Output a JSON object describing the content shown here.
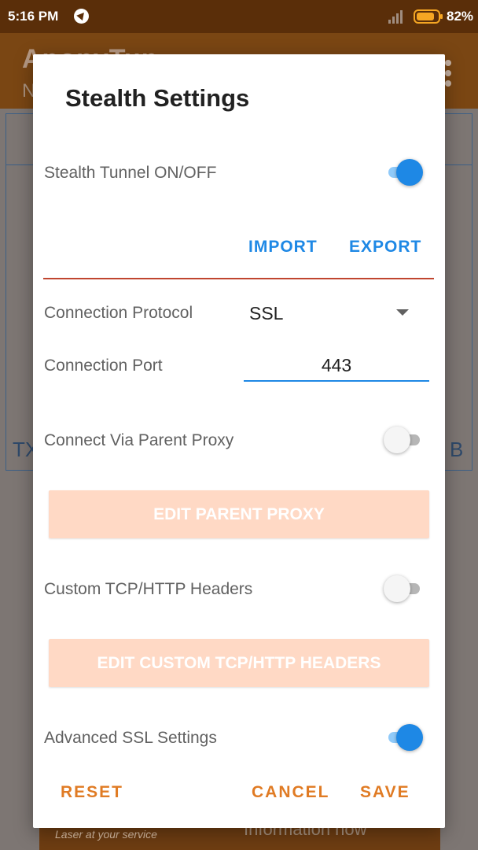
{
  "status_bar": {
    "time": "5:16 PM",
    "battery_percent": "82%",
    "battery_level": 0.82,
    "nav_icon": "navigation-icon"
  },
  "background_app": {
    "title": "AnonyTun",
    "subtitle": "N",
    "left_label": "TX",
    "right_label": "B",
    "banner_tagline": "Laser at your service",
    "banner_info": "Information now"
  },
  "dialog": {
    "title": "Stealth Settings",
    "stealth_tunnel": {
      "label": "Stealth Tunnel ON/OFF",
      "on": true
    },
    "import_label": "IMPORT",
    "export_label": "EXPORT",
    "connection_protocol": {
      "label": "Connection Protocol",
      "value": "SSL"
    },
    "connection_port": {
      "label": "Connection Port",
      "value": "443"
    },
    "parent_proxy": {
      "label": "Connect Via Parent Proxy",
      "on": false,
      "edit_label": "EDIT PARENT PROXY"
    },
    "custom_headers": {
      "label": "Custom TCP/HTTP Headers",
      "on": false,
      "edit_label": "EDIT CUSTOM TCP/HTTP HEADERS"
    },
    "advanced_ssl": {
      "label": "Advanced SSL Settings",
      "on": true
    },
    "reset_label": "RESET",
    "cancel_label": "CANCEL",
    "save_label": "SAVE"
  },
  "colors": {
    "accent_blue": "#1e88e5",
    "action_orange": "#e07b24",
    "disabled_button": "#ffd9c5",
    "divider_red": "#c0452f"
  }
}
